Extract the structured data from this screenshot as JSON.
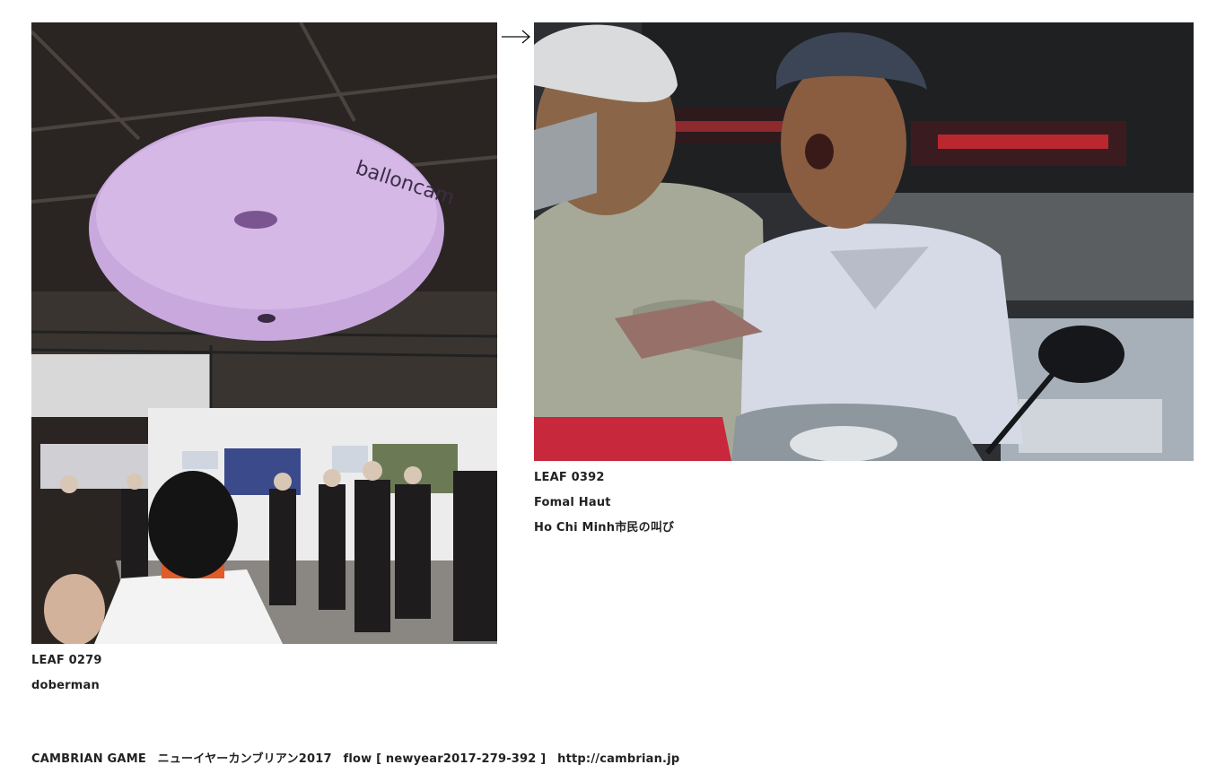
{
  "leaves": [
    {
      "id_label": "LEAF 0279",
      "author": "doberman",
      "title": "",
      "balloon_text": "balloncam"
    },
    {
      "id_label": "LEAF 0392",
      "author": "Fomal Haut",
      "title": "Ho Chi Minh市民の叫び"
    }
  ],
  "flow_arrow": "→",
  "footer": {
    "game": "CAMBRIAN GAME",
    "event": "ニューイヤーカンブリアン2017",
    "flow": "flow [ newyear2017-279-392 ]",
    "link": "http://cambrian.jp"
  }
}
